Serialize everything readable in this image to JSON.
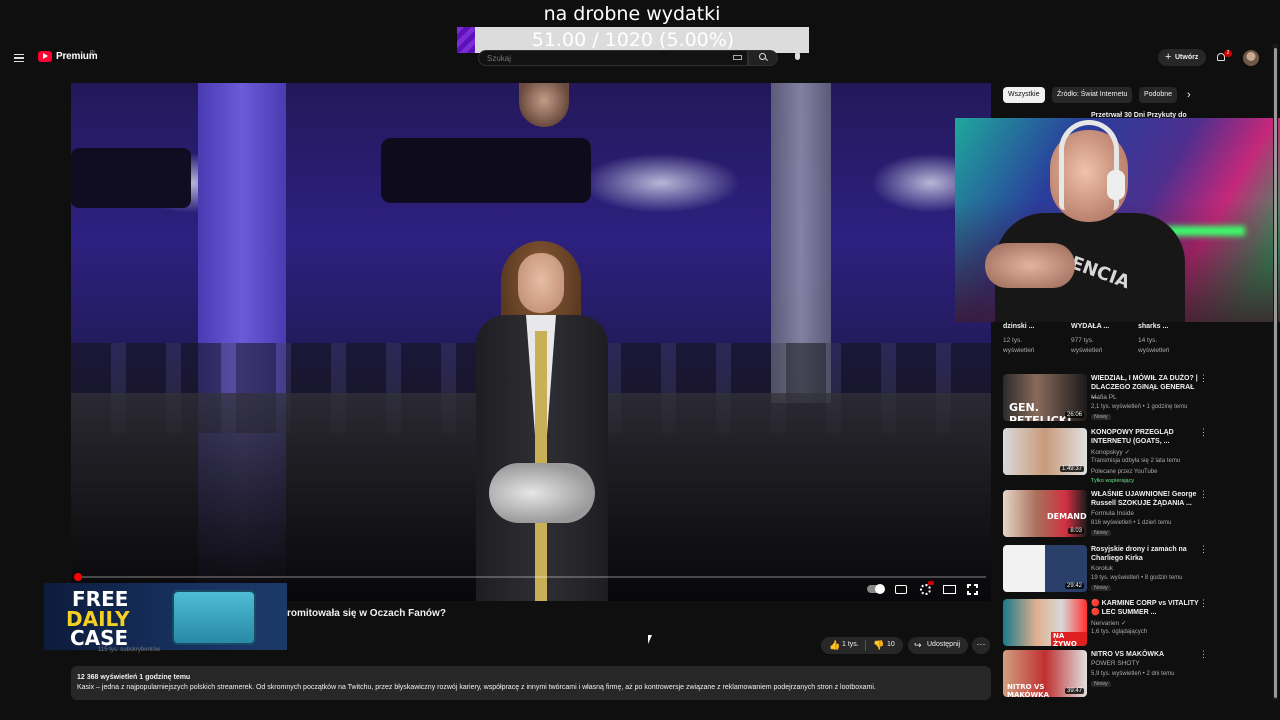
{
  "overlay": {
    "goal_title": "na drobne wydatki",
    "goal_progress_text": "51.00 / 1020 (5.00%)",
    "goal_fraction": 0.05
  },
  "header": {
    "logo_text": "Premium",
    "region": "PL",
    "search_placeholder": "Szukaj",
    "create_label": "Utwórz",
    "notification_count": "2"
  },
  "player": {
    "played_fraction": 0.004
  },
  "banner": {
    "line1": "FREE",
    "line2": "DAILY",
    "line3": "CASE"
  },
  "video": {
    "title_visible": "romitowała się w Oczach Fanów?",
    "channel_subs": "115 tys. subskrybentów",
    "likes": "1 tys.",
    "dislikes": "10",
    "share_label": "Udostępnij",
    "more": "···",
    "description_meta": "12 368 wyświetleń  1 godzinę temu",
    "description_text": "Kasix – jedna z najpopularniejszych polskich streamerek. Od skromnych początków na Twitchu, przez błyskawiczny rozwój kariery, współpracę z innymi twórcami i własną firmę, aż po kontrowersje związane z reklamowaniem podejrzanych stron z lootboxami."
  },
  "chips": [
    {
      "label": "Wszystkie",
      "active": true
    },
    {
      "label": "Źródło: Świat Internetu",
      "active": false
    },
    {
      "label": "Podobne",
      "active": false
    }
  ],
  "partial_top_title": "Przetrwał 30 Dni Przykuty do",
  "webcam": {
    "shirt_text": "ALENCIA"
  },
  "shorts": [
    {
      "title": "dzinski ...",
      "views": "12 tys.",
      "unit": "wyświetleń"
    },
    {
      "title": "WYDAŁA ...",
      "views": "977 tys.",
      "unit": "wyświetleń"
    },
    {
      "title": "sharks ...",
      "views": "14 tys.",
      "unit": "wyświetleń"
    }
  ],
  "related": [
    {
      "title": "WIEDZIAŁ, I MÓWIŁ ZA DUŻO? | DLACZEGO ZGINĄŁ GENERAŁ ...",
      "channel": "Mafia PL",
      "meta": "2,1 tys. wyświetleń • 1 godzinę temu",
      "badge": "Nowy",
      "duration": "26:06",
      "thumb_text": "GEN. PETELICKI"
    },
    {
      "title": "KONOPOWY PRZEGLĄD INTERNETU (GOATS, ...",
      "channel": "Konopskyy ✓",
      "meta": "Transmisja odbyła się 2 lata temu",
      "badge": "Polecane przez YouTube",
      "badge2": "Tylko wspierający",
      "duration": "1:49:37",
      "thumb_text": ""
    },
    {
      "title": "WŁAŚNIE UJAWNIONE! George Russell SZOKUJE ŻĄDANIA ...",
      "channel": "Formula Inside",
      "meta": "816 wyświetleń • 1 dzień temu",
      "badge": "Nowy",
      "duration": "8:03",
      "thumb_text": "DEMANDS"
    },
    {
      "title": "Rosyjskie drony i zamach na Charliego Kirka",
      "channel": "Koroluk",
      "meta": "19 tys. wyświetleń • 8 godzin temu",
      "badge": "Nowy",
      "duration": "29:42",
      "thumb_text": ""
    },
    {
      "title": "🔴 KARMINE CORP vs VITALITY 🔴 LEC SUMMER ...",
      "channel": "Nervarien ✓",
      "meta": "1,6 tys. oglądających",
      "badge": "",
      "duration": "",
      "thumb_text": "NA ŻYWO"
    },
    {
      "title": "NITRO VS MAKÓWKA",
      "channel": "POWER SHOTY",
      "meta": "5,9 tys. wyświetleń • 2 dni temu",
      "badge": "Nowy",
      "duration": "39:47",
      "thumb_text": "NITRO VS MAKÓWKA"
    }
  ]
}
